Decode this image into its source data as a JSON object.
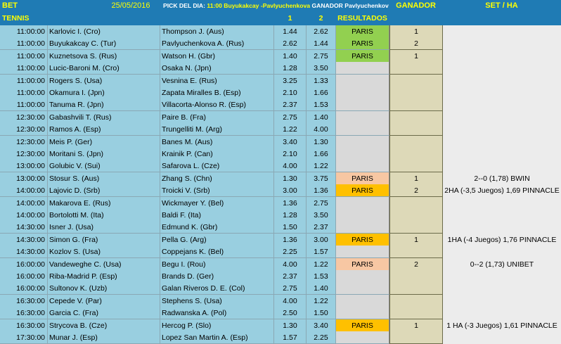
{
  "header": {
    "bet_label": "BET",
    "date": "25/05/2016",
    "pick_prefix": "PICK DEL DIA:",
    "pick_time_match": "11:00 Buyukakcay -Pavlyuchenkova",
    "pick_winner": "GANADOR Pavlyuchenkova 1.44",
    "ganador_label": "GANADOR",
    "set_ha_label": "SET / HA"
  },
  "subheader": {
    "sport": "TENNIS",
    "col_1": "1",
    "col_2": "2",
    "resultados": "RESULTADOS"
  },
  "colors": {
    "header_bg": "#1f7bb4",
    "header_text": "#ffff00",
    "row_bg": "#99cfe0",
    "result_green": "#92d050",
    "result_salmon": "#f7c7a3",
    "result_orange": "#ffc000",
    "ganador_bg": "#ddd9b8"
  },
  "rows": [
    {
      "time": "11:00:00",
      "home": "Karlovic I. (Cro)",
      "away": "Thompson J. (Aus)",
      "o1": "1.44",
      "o2": "2.62",
      "res": "PARIS",
      "res_color": "green",
      "ganador": "1",
      "set": ""
    },
    {
      "time": "11:00:00",
      "home": "Buyukakcay C. (Tur)",
      "away": "Pavlyuchenkova A. (Rus)",
      "o1": "2.62",
      "o2": "1.44",
      "res": "PARIS",
      "res_color": "green",
      "ganador": "2",
      "set": ""
    },
    {
      "time": "11:00:00",
      "home": "Kuznetsova S. (Rus)",
      "away": "Watson H. (Gbr)",
      "o1": "1.40",
      "o2": "2.75",
      "res": "PARIS",
      "res_color": "green",
      "ganador": "1",
      "set": ""
    },
    {
      "time": "11:00:00",
      "home": "Lucic-Baroni M. (Cro)",
      "away": "Osaka N. (Jpn)",
      "o1": "1.28",
      "o2": "3.50",
      "res": "",
      "res_color": "",
      "ganador": "",
      "set": ""
    },
    {
      "time": "11:00:00",
      "home": "Rogers S. (Usa)",
      "away": "Vesnina E. (Rus)",
      "o1": "3.25",
      "o2": "1.33",
      "res": "",
      "res_color": "",
      "ganador": "",
      "set": ""
    },
    {
      "time": "11:00:00",
      "home": "Okamura I. (Jpn)",
      "away": "Zapata Miralles B. (Esp)",
      "o1": "2.10",
      "o2": "1.66",
      "res": "",
      "res_color": "",
      "ganador": "",
      "set": ""
    },
    {
      "time": "11:00:00",
      "home": "Tanuma R. (Jpn)",
      "away": "Villacorta-Alonso R. (Esp)",
      "o1": "2.37",
      "o2": "1.53",
      "res": "",
      "res_color": "",
      "ganador": "",
      "set": ""
    },
    {
      "time": "12:30:00",
      "home": "Gabashvili T. (Rus)",
      "away": "Paire B. (Fra)",
      "o1": "2.75",
      "o2": "1.40",
      "res": "",
      "res_color": "",
      "ganador": "",
      "set": ""
    },
    {
      "time": "12:30:00",
      "home": "Ramos A. (Esp)",
      "away": "Trungelliti M. (Arg)",
      "o1": "1.22",
      "o2": "4.00",
      "res": "",
      "res_color": "",
      "ganador": "",
      "set": ""
    },
    {
      "time": "12:30:00",
      "home": "Meis P. (Ger)",
      "away": "Banes M. (Aus)",
      "o1": "3.40",
      "o2": "1.30",
      "res": "",
      "res_color": "",
      "ganador": "",
      "set": ""
    },
    {
      "time": "12:30:00",
      "home": "Moritani S. (Jpn)",
      "away": "Krainik P. (Can)",
      "o1": "2.10",
      "o2": "1.66",
      "res": "",
      "res_color": "",
      "ganador": "",
      "set": ""
    },
    {
      "time": "13:00:00",
      "home": "Golubic V. (Sui)",
      "away": "Safarova L. (Cze)",
      "o1": "4.00",
      "o2": "1.22",
      "res": "",
      "res_color": "",
      "ganador": "",
      "set": ""
    },
    {
      "time": "13:00:00",
      "home": "Stosur S. (Aus)",
      "away": "Zhang S. (Chn)",
      "o1": "1.30",
      "o2": "3.75",
      "res": "PARIS",
      "res_color": "salmon",
      "ganador": "1",
      "set": "2--0 (1,78) BWIN"
    },
    {
      "time": "14:00:00",
      "home": "Lajovic D. (Srb)",
      "away": "Troicki V. (Srb)",
      "o1": "3.00",
      "o2": "1.36",
      "res": "PARIS",
      "res_color": "orange",
      "ganador": "2",
      "set": "2HA (-3,5 Juegos) 1,69 PINNACLE"
    },
    {
      "time": "14:00:00",
      "home": "Makarova E. (Rus)",
      "away": "Wickmayer Y. (Bel)",
      "o1": "1.36",
      "o2": "2.75",
      "res": "",
      "res_color": "",
      "ganador": "",
      "set": ""
    },
    {
      "time": "14:00:00",
      "home": "Bortolotti M. (Ita)",
      "away": "Baldi F. (Ita)",
      "o1": "1.28",
      "o2": "3.50",
      "res": "",
      "res_color": "",
      "ganador": "",
      "set": ""
    },
    {
      "time": "14:30:00",
      "home": "Isner J. (Usa)",
      "away": "Edmund K. (Gbr)",
      "o1": "1.50",
      "o2": "2.37",
      "res": "",
      "res_color": "",
      "ganador": "",
      "set": ""
    },
    {
      "time": "14:30:00",
      "home": "Simon G. (Fra)",
      "away": "Pella G. (Arg)",
      "o1": "1.36",
      "o2": "3.00",
      "res": "PARIS",
      "res_color": "orange",
      "ganador": "1",
      "set": "1HA (-4 Juegos) 1,76 PINNACLE"
    },
    {
      "time": "14:30:00",
      "home": "Kozlov S. (Usa)",
      "away": "Coppejans K. (Bel)",
      "o1": "2.25",
      "o2": "1.57",
      "res": "",
      "res_color": "",
      "ganador": "",
      "set": ""
    },
    {
      "time": "16:00:00",
      "home": "Vandeweghe C. (Usa)",
      "away": "Begu I. (Rou)",
      "o1": "4.00",
      "o2": "1.22",
      "res": "PARIS",
      "res_color": "salmon",
      "ganador": "2",
      "set": "0--2 (1,73) UNIBET"
    },
    {
      "time": "16:00:00",
      "home": "Riba-Madrid P. (Esp)",
      "away": "Brands D. (Ger)",
      "o1": "2.37",
      "o2": "1.53",
      "res": "",
      "res_color": "",
      "ganador": "",
      "set": ""
    },
    {
      "time": "16:00:00",
      "home": "Sultonov K. (Uzb)",
      "away": "Galan Riveros D. E. (Col)",
      "o1": "2.75",
      "o2": "1.40",
      "res": "",
      "res_color": "",
      "ganador": "",
      "set": ""
    },
    {
      "time": "16:30:00",
      "home": "Cepede V. (Par)",
      "away": "Stephens S. (Usa)",
      "o1": "4.00",
      "o2": "1.22",
      "res": "",
      "res_color": "",
      "ganador": "",
      "set": ""
    },
    {
      "time": "16:30:00",
      "home": "Garcia C. (Fra)",
      "away": "Radwanska A. (Pol)",
      "o1": "2.50",
      "o2": "1.50",
      "res": "",
      "res_color": "",
      "ganador": "",
      "set": ""
    },
    {
      "time": "16:30:00",
      "home": "Strycova B. (Cze)",
      "away": "Hercog P. (Slo)",
      "o1": "1.30",
      "o2": "3.40",
      "res": "PARIS",
      "res_color": "orange",
      "ganador": "1",
      "set": "1 HA (-3 Juegos) 1,61 PINNACLE"
    },
    {
      "time": "17:30:00",
      "home": "Munar J. (Esp)",
      "away": "Lopez San Martin A. (Esp)",
      "o1": "1.57",
      "o2": "2.25",
      "res": "",
      "res_color": "",
      "ganador": "",
      "set": ""
    }
  ]
}
